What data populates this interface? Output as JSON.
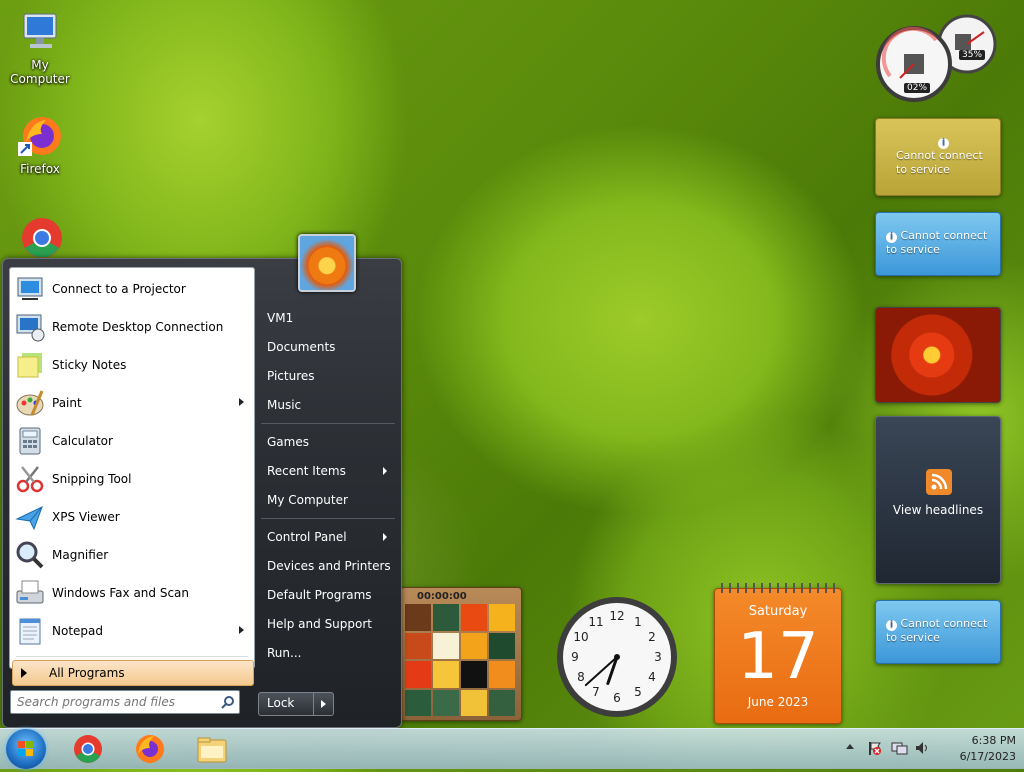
{
  "desktop": {
    "icons": [
      {
        "label": "My Computer",
        "icon": "computer-icon"
      },
      {
        "label": "Firefox",
        "icon": "firefox-icon"
      },
      {
        "label": "",
        "icon": "chrome-icon"
      }
    ]
  },
  "start_menu": {
    "programs": [
      {
        "label": "Connect to a Projector",
        "icon": "projector-icon",
        "has_submenu": false
      },
      {
        "label": "Remote Desktop Connection",
        "icon": "remote-desktop-icon",
        "has_submenu": false
      },
      {
        "label": "Sticky Notes",
        "icon": "sticky-notes-icon",
        "has_submenu": false
      },
      {
        "label": "Paint",
        "icon": "paint-icon",
        "has_submenu": true
      },
      {
        "label": "Calculator",
        "icon": "calculator-icon",
        "has_submenu": false
      },
      {
        "label": "Snipping Tool",
        "icon": "snipping-tool-icon",
        "has_submenu": false
      },
      {
        "label": "XPS Viewer",
        "icon": "xps-viewer-icon",
        "has_submenu": false
      },
      {
        "label": "Magnifier",
        "icon": "magnifier-icon",
        "has_submenu": false
      },
      {
        "label": "Windows Fax and Scan",
        "icon": "fax-scan-icon",
        "has_submenu": false
      },
      {
        "label": "Notepad",
        "icon": "notepad-icon",
        "has_submenu": true
      }
    ],
    "all_programs": "All Programs",
    "search_placeholder": "Search programs and files",
    "right_links": {
      "user": "VM1",
      "documents": "Documents",
      "pictures": "Pictures",
      "music": "Music",
      "games": "Games",
      "recent_items": "Recent Items",
      "my_computer": "My Computer",
      "control_panel": "Control Panel",
      "devices_printers": "Devices and Printers",
      "default_programs": "Default Programs",
      "help_support": "Help and Support",
      "run": "Run..."
    },
    "lock_label": "Lock"
  },
  "gadgets": {
    "cpu_meter": {
      "cpu": "02%",
      "memory": "35%"
    },
    "currency": {
      "message": "Cannot connect to service"
    },
    "weather": {
      "message": "Cannot connect to service"
    },
    "feed": {
      "label": "View headlines"
    },
    "stocks": {
      "message": "Cannot connect to service"
    },
    "puzzle": {
      "time": "00:00:00"
    },
    "clock": {
      "hour": 6,
      "minute": 38
    },
    "calendar": {
      "weekday": "Saturday",
      "day": "17",
      "month_year": "June 2023"
    }
  },
  "taskbar": {
    "items": [
      "chrome-icon",
      "firefox-icon",
      "explorer-icon"
    ],
    "time": "6:38 PM",
    "date": "6/17/2023"
  },
  "colors": {
    "accent": "#1f6fc2",
    "calendar": "#f07a1a",
    "highlight": "#f4c98f"
  }
}
